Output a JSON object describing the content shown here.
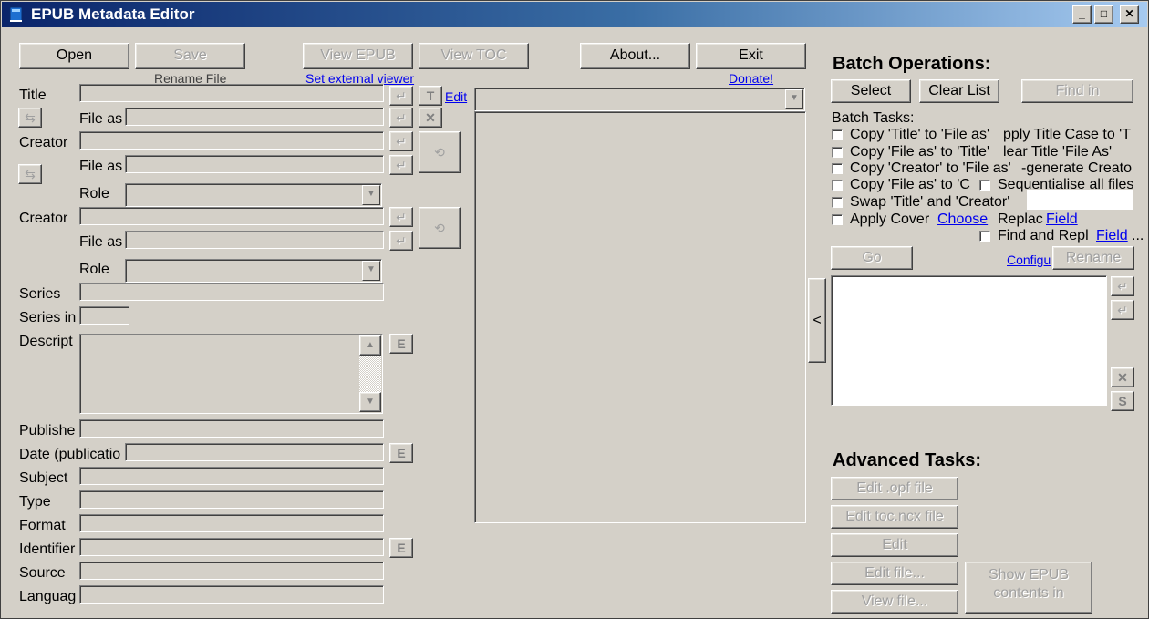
{
  "window": {
    "title": "EPUB Metadata Editor",
    "caption_buttons": {
      "minimize": "_",
      "maximize": "□",
      "close": "✕"
    }
  },
  "toolbar": {
    "open": "Open",
    "save": "Save",
    "view_epub": "View EPUB",
    "view_toc": "View TOC",
    "about": "About...",
    "exit": "Exit",
    "rename_file": "Rename File",
    "set_external_viewer": "Set external viewer",
    "donate": "Donate!"
  },
  "metadata": {
    "title_label": "Title",
    "file_as_label": "File as",
    "creator_label": "Creator",
    "role_label": "Role",
    "series_label": "Series",
    "series_index_label": "Series in",
    "description_label": "Descript",
    "publisher_label": "Publishe",
    "date_label": "Date (publicatio",
    "subject_label": "Subject",
    "type_label": "Type",
    "format_label": "Format",
    "identifier_label": "Identifier",
    "source_label": "Source",
    "language_label": "Languag",
    "edit_link": "Edit",
    "title_case_btn": "T",
    "extra_btn": "E"
  },
  "batch": {
    "heading": "Batch Operations:",
    "select": "Select",
    "clear_list": "Clear List",
    "find_in": "Find in",
    "tasks_label": "Batch Tasks:",
    "tasks": {
      "copy_title_fileas": "Copy 'Title' to 'File as'",
      "apply_title_case": "pply Title Case to 'T",
      "copy_fileas_title": "Copy 'File as' to 'Title'",
      "clear_title_fileas": "lear Title 'File As'",
      "copy_creator_fileas": "Copy 'Creator' to 'File as'",
      "regenerate_creator": "-generate Creato",
      "copy_fileas_creator": "Copy 'File as' to 'C",
      "sequentialise": "Sequentialise all files",
      "swap_title_creator": "Swap 'Title' and 'Creator'",
      "apply_cover": "Apply Cover",
      "choose": "Choose",
      "replace": "Replac",
      "field": "Field",
      "find_replace": "Find and Repl",
      "field2": "Field",
      "ellipsis": "..."
    },
    "go": "Go",
    "configure": "Configu",
    "rename": "Rename",
    "collapse": "<"
  },
  "advanced": {
    "heading": "Advanced Tasks:",
    "edit_opf": "Edit .opf file",
    "edit_toc": "Edit toc.ncx file",
    "edit": "Edit",
    "edit_file": "Edit file...",
    "view_file": "View file...",
    "show_epub_contents": "Show EPUB contents in"
  },
  "colors": {
    "face": "#d4d0c8",
    "titlebar_start": "#0a246a",
    "titlebar_end": "#a6caf0",
    "link": "#0000ee"
  }
}
